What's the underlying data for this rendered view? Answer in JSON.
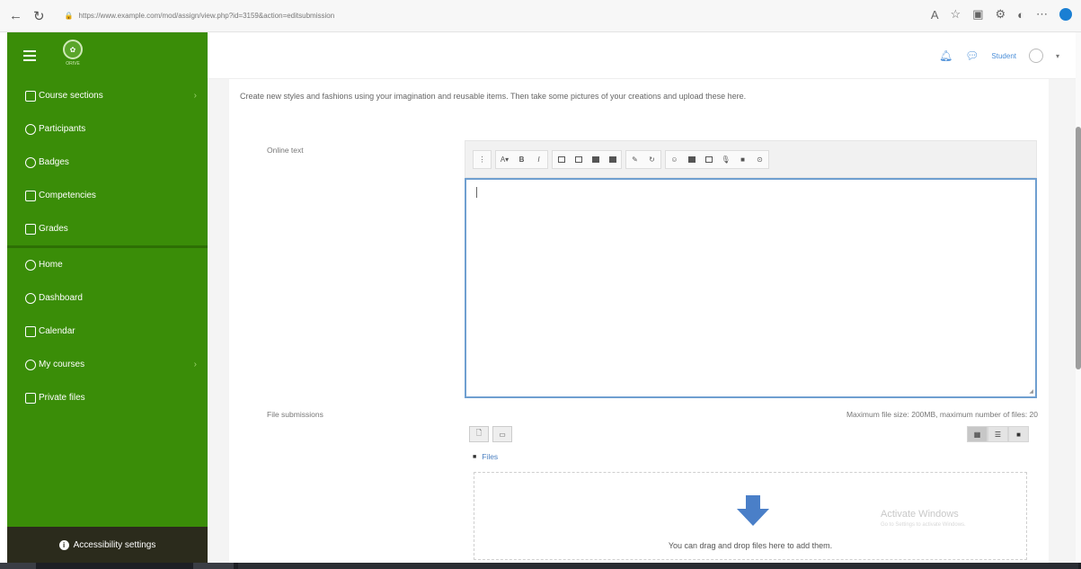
{
  "browser": {
    "url": "https://www.example.com/mod/assign/view.php?id=3159&action=editsubmission",
    "right_icons": [
      "read-aloud-icon",
      "favorite-icon",
      "collections-icon",
      "extensions-icon",
      "profile-icon",
      "edge-icon"
    ]
  },
  "sidebar": {
    "logo_caption": "ORIVE",
    "items": [
      {
        "label": "Course sections",
        "icon": "book-icon",
        "has_chevron": true
      },
      {
        "label": "Participants",
        "icon": "users-icon",
        "has_chevron": false
      },
      {
        "label": "Badges",
        "icon": "badge-icon",
        "has_chevron": false
      },
      {
        "label": "Competencies",
        "icon": "star-icon",
        "has_chevron": false
      },
      {
        "label": "Grades",
        "icon": "grid-icon",
        "has_chevron": false
      }
    ],
    "items2": [
      {
        "label": "Home",
        "icon": "home-icon",
        "has_chevron": false
      },
      {
        "label": "Dashboard",
        "icon": "dashboard-icon",
        "has_chevron": false
      },
      {
        "label": "Calendar",
        "icon": "calendar-icon",
        "has_chevron": false
      },
      {
        "label": "My courses",
        "icon": "graduation-cap-icon",
        "has_chevron": true
      },
      {
        "label": "Private files",
        "icon": "file-icon",
        "has_chevron": false
      }
    ],
    "accessibility_label": "Accessibility settings"
  },
  "topbar": {
    "user_label": "Student"
  },
  "main": {
    "intro": "Create new styles and fashions using your imagination and reusable items. Then take some pictures of your creations and upload these here.",
    "online_text_label": "Online text",
    "file_submissions_label": "File submissions",
    "max_size_text": "Maximum file size: 200MB, maximum number of files: 20",
    "files_label": "Files",
    "drop_text": "You can drag and drop files here to add them."
  },
  "watermark": {
    "title": "Activate Windows",
    "sub": "Go to Settings to activate Windows."
  },
  "colors": {
    "sidebar_green": "#3a8d08",
    "accent_blue": "#4a8ed8"
  }
}
